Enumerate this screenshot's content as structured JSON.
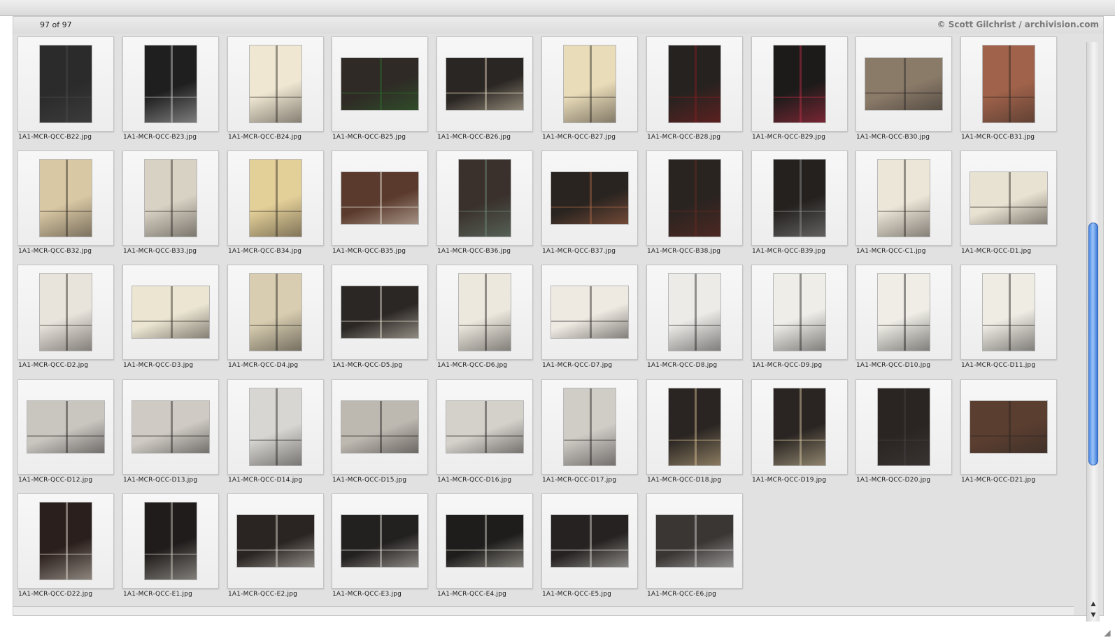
{
  "toolbar": {},
  "viewer": {
    "counter": "97 of 97",
    "credit": "© Scott Gilchrist / archivision.com"
  },
  "thumbnails": [
    {
      "label": "1A1-MCR-QCC-B22.jpg",
      "orient": "portrait",
      "tone": "#2b2b2b",
      "accent": "#4a4a4a"
    },
    {
      "label": "1A1-MCR-QCC-B23.jpg",
      "orient": "portrait",
      "tone": "#1f1f1f",
      "accent": "#cfcfcf"
    },
    {
      "label": "1A1-MCR-QCC-B24.jpg",
      "orient": "portrait",
      "tone": "#efe7d2",
      "accent": "#2a2522"
    },
    {
      "label": "1A1-MCR-QCC-B25.jpg",
      "orient": "landscape",
      "tone": "#2f2a26",
      "accent": "#2f6b2c"
    },
    {
      "label": "1A1-MCR-QCC-B26.jpg",
      "orient": "landscape",
      "tone": "#2a2623",
      "accent": "#e8dcc0"
    },
    {
      "label": "1A1-MCR-QCC-B27.jpg",
      "orient": "portrait",
      "tone": "#e9dcb9",
      "accent": "#2a2522"
    },
    {
      "label": "1A1-MCR-QCC-B28.jpg",
      "orient": "portrait",
      "tone": "#262220",
      "accent": "#8a2020"
    },
    {
      "label": "1A1-MCR-QCC-B29.jpg",
      "orient": "portrait",
      "tone": "#1d1b1a",
      "accent": "#c8304a"
    },
    {
      "label": "1A1-MCR-QCC-B30.jpg",
      "orient": "landscape",
      "tone": "#8a7a68",
      "accent": "#2b2827"
    },
    {
      "label": "1A1-MCR-QCC-B31.jpg",
      "orient": "portrait",
      "tone": "#a0624a",
      "accent": "#2a2522"
    },
    {
      "label": "1A1-MCR-QCC-B32.jpg",
      "orient": "portrait",
      "tone": "#d9c8a4",
      "accent": "#2a2522"
    },
    {
      "label": "1A1-MCR-QCC-B33.jpg",
      "orient": "portrait",
      "tone": "#d8d2c4",
      "accent": "#2a2522"
    },
    {
      "label": "1A1-MCR-QCC-B34.jpg",
      "orient": "portrait",
      "tone": "#e3cf98",
      "accent": "#2a2522"
    },
    {
      "label": "1A1-MCR-QCC-B35.jpg",
      "orient": "landscape",
      "tone": "#5a3a2c",
      "accent": "#e6e0d4"
    },
    {
      "label": "1A1-MCR-QCC-B36.jpg",
      "orient": "portrait",
      "tone": "#3a312c",
      "accent": "#6d8a7a"
    },
    {
      "label": "1A1-MCR-QCC-B37.jpg",
      "orient": "landscape",
      "tone": "#2a2420",
      "accent": "#b06a4a"
    },
    {
      "label": "1A1-MCR-QCC-B38.jpg",
      "orient": "portrait",
      "tone": "#2a2421",
      "accent": "#6a2a22"
    },
    {
      "label": "1A1-MCR-QCC-B39.jpg",
      "orient": "portrait",
      "tone": "#24211f",
      "accent": "#9a9a9a"
    },
    {
      "label": "1A1-MCR-QCC-C1.jpg",
      "orient": "portrait",
      "tone": "#ece6d8",
      "accent": "#2a2522"
    },
    {
      "label": "1A1-MCR-QCC-D1.jpg",
      "orient": "landscape",
      "tone": "#e8e2d2",
      "accent": "#2a2522"
    },
    {
      "label": "1A1-MCR-QCC-D2.jpg",
      "orient": "portrait",
      "tone": "#e8e4dc",
      "accent": "#2a2522"
    },
    {
      "label": "1A1-MCR-QCC-D3.jpg",
      "orient": "landscape",
      "tone": "#ebe5d2",
      "accent": "#2a2522"
    },
    {
      "label": "1A1-MCR-QCC-D4.jpg",
      "orient": "portrait",
      "tone": "#d8cdb0",
      "accent": "#1f1d1c"
    },
    {
      "label": "1A1-MCR-QCC-D5.jpg",
      "orient": "landscape",
      "tone": "#2b2725",
      "accent": "#ebe5d2"
    },
    {
      "label": "1A1-MCR-QCC-D6.jpg",
      "orient": "portrait",
      "tone": "#ece8de",
      "accent": "#232020"
    },
    {
      "label": "1A1-MCR-QCC-D7.jpg",
      "orient": "landscape",
      "tone": "#eeeae2",
      "accent": "#232020"
    },
    {
      "label": "1A1-MCR-QCC-D8.jpg",
      "orient": "portrait",
      "tone": "#ecebe8",
      "accent": "#1f1d1c"
    },
    {
      "label": "1A1-MCR-QCC-D9.jpg",
      "orient": "portrait",
      "tone": "#eeede8",
      "accent": "#1f1d1c"
    },
    {
      "label": "1A1-MCR-QCC-D10.jpg",
      "orient": "portrait",
      "tone": "#efede6",
      "accent": "#1f1d1c"
    },
    {
      "label": "1A1-MCR-QCC-D11.jpg",
      "orient": "portrait",
      "tone": "#efece4",
      "accent": "#1f1d1c"
    },
    {
      "label": "1A1-MCR-QCC-D12.jpg",
      "orient": "landscape",
      "tone": "#c9c6c0",
      "accent": "#232020"
    },
    {
      "label": "1A1-MCR-QCC-D13.jpg",
      "orient": "landscape",
      "tone": "#cfcbc4",
      "accent": "#232020"
    },
    {
      "label": "1A1-MCR-QCC-D14.jpg",
      "orient": "portrait",
      "tone": "#d8d6d2",
      "accent": "#232020"
    },
    {
      "label": "1A1-MCR-QCC-D15.jpg",
      "orient": "landscape",
      "tone": "#bdb8b0",
      "accent": "#232020"
    },
    {
      "label": "1A1-MCR-QCC-D16.jpg",
      "orient": "landscape",
      "tone": "#d4d0ca",
      "accent": "#232020"
    },
    {
      "label": "1A1-MCR-QCC-D17.jpg",
      "orient": "portrait",
      "tone": "#d0ccc6",
      "accent": "#232020"
    },
    {
      "label": "1A1-MCR-QCC-D18.jpg",
      "orient": "portrait",
      "tone": "#2a2522",
      "accent": "#e0c898"
    },
    {
      "label": "1A1-MCR-QCC-D19.jpg",
      "orient": "portrait",
      "tone": "#2a2522",
      "accent": "#e8d8b0"
    },
    {
      "label": "1A1-MCR-QCC-D20.jpg",
      "orient": "portrait",
      "tone": "#2a2522",
      "accent": "#444040"
    },
    {
      "label": "1A1-MCR-QCC-D21.jpg",
      "orient": "landscape",
      "tone": "#5a3e30",
      "accent": "#2a2522"
    },
    {
      "label": "1A1-MCR-QCC-D22.jpg",
      "orient": "portrait",
      "tone": "#2a1f1c",
      "accent": "#e6e0d4"
    },
    {
      "label": "1A1-MCR-QCC-E1.jpg",
      "orient": "portrait",
      "tone": "#1f1c1b",
      "accent": "#d8d4cc"
    },
    {
      "label": "1A1-MCR-QCC-E2.jpg",
      "orient": "landscape",
      "tone": "#2a2522",
      "accent": "#e8e4dc"
    },
    {
      "label": "1A1-MCR-QCC-E3.jpg",
      "orient": "landscape",
      "tone": "#232020",
      "accent": "#e6e2da"
    },
    {
      "label": "1A1-MCR-QCC-E4.jpg",
      "orient": "landscape",
      "tone": "#1f1d1c",
      "accent": "#dcd8cc"
    },
    {
      "label": "1A1-MCR-QCC-E5.jpg",
      "orient": "landscape",
      "tone": "#252221",
      "accent": "#e4e2dc"
    },
    {
      "label": "1A1-MCR-QCC-E6.jpg",
      "orient": "landscape",
      "tone": "#3a3634",
      "accent": "#e2e2e2"
    }
  ],
  "scrollbar": {
    "position_fraction": 0.58,
    "up_arrow": "▲",
    "down_arrow": "▼"
  },
  "resize_grip": "◢"
}
